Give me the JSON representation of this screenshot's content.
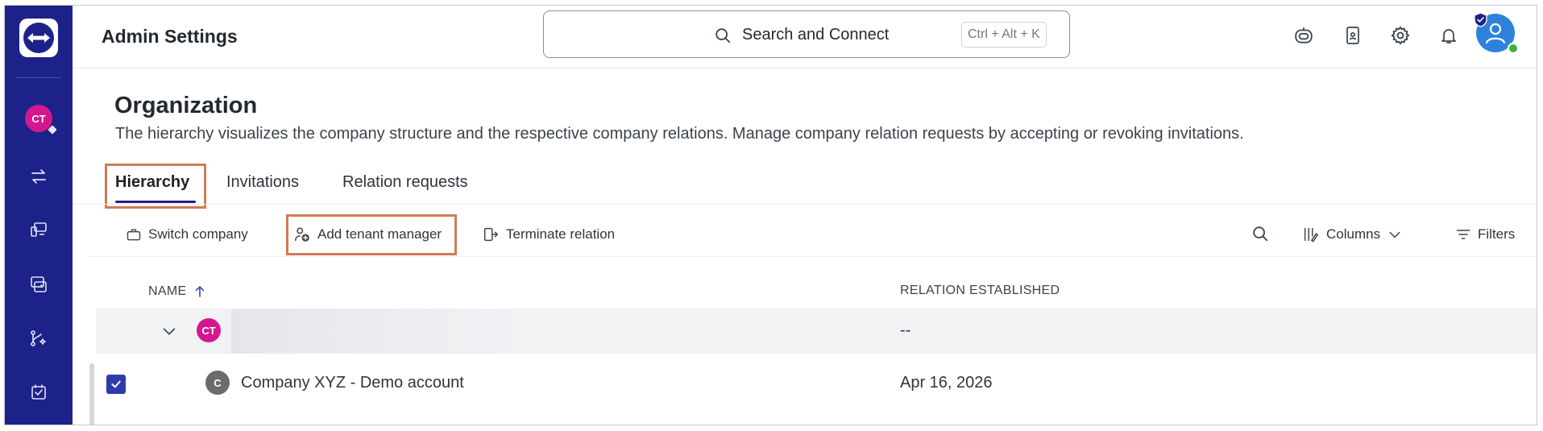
{
  "header": {
    "title": "Admin Settings",
    "search": {
      "label": "Search and Connect",
      "shortcut": "Ctrl + Alt + K"
    }
  },
  "sidebar": {
    "account_initials": "CT",
    "items": [
      {
        "icon": "arrows-transfer-icon"
      },
      {
        "icon": "devices-icon"
      },
      {
        "icon": "remote-session-icon"
      },
      {
        "icon": "ai-workflow-icon"
      },
      {
        "icon": "task-check-icon"
      }
    ]
  },
  "page": {
    "title": "Organization",
    "description": "The hierarchy visualizes the company structure and the respective company relations. Manage company relation requests by accepting or revoking invitations.",
    "tabs": [
      {
        "label": "Hierarchy",
        "active": true
      },
      {
        "label": "Invitations",
        "active": false
      },
      {
        "label": "Relation requests",
        "active": false
      }
    ]
  },
  "toolbar": {
    "switch_company": "Switch company",
    "add_tenant_manager": "Add tenant manager",
    "terminate_relation": "Terminate relation",
    "columns": "Columns",
    "filters": "Filters"
  },
  "table": {
    "columns": [
      "NAME",
      "RELATION ESTABLISHED"
    ],
    "sort": {
      "column": "NAME",
      "direction": "ascending"
    },
    "rows": [
      {
        "initials": "CT",
        "name": "",
        "relation_established": "--",
        "expanded": true,
        "level": 0
      },
      {
        "initials": "C",
        "name": "Company XYZ - Demo account",
        "relation_established": "Apr 16, 2026",
        "selected": true,
        "level": 1
      }
    ]
  },
  "colors": {
    "sidebar": "#1c2289",
    "accent": "#2c3dab",
    "highlight": "#cf7c55",
    "avatar_pink": "#d4178f",
    "avatar_gray": "#6b6b6b",
    "status_online": "#3fb43b"
  }
}
